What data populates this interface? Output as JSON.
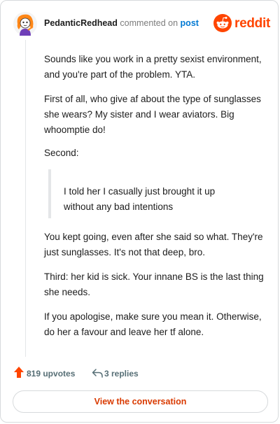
{
  "header": {
    "username": "PedanticRedhead",
    "action_text": "commented on",
    "post_link": "post",
    "brand": "reddit",
    "brand_icon": "reddit-logo-icon",
    "avatar_icon": "avatar-icon"
  },
  "comment": {
    "paragraphs": [
      "Sounds like you work in a pretty sexist environment, and you're part of the problem. YTA.",
      "First of all, who give af about the type of sunglasses she wears? My sister and I wear aviators. Big whoomptie do!",
      "Second:",
      "I told her I casually just brought it up without any bad intentions",
      "You kept going, even after she said so what. They're just sunglasses. It's not that deep, bro.",
      "Third: her kid is sick. Your innane BS is the last thing she needs.",
      "If you apologise, make sure you mean it. Otherwise, do her a favour and leave her tf alone."
    ]
  },
  "footer": {
    "upvotes": "819 upvotes",
    "replies": "3 replies",
    "upvote_icon": "upvote-arrow-icon",
    "reply_icon": "reply-icon"
  },
  "cta": {
    "label": "View the conversation"
  },
  "colors": {
    "brand": "#ff4500",
    "link": "#0079d3",
    "cta": "#d93a00",
    "muted": "#576f76"
  }
}
